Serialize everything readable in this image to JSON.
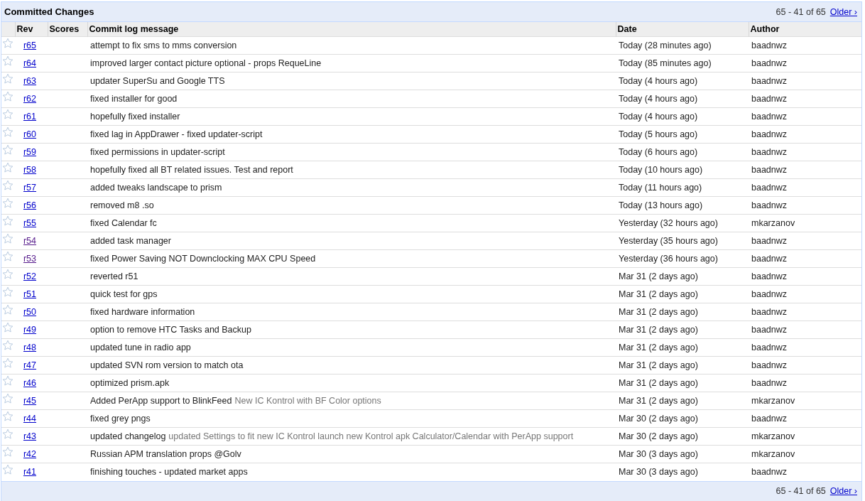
{
  "title": "Committed Changes",
  "pager": {
    "range": "65 - 41 of 65",
    "older": "Older ›"
  },
  "columns": [
    "Rev",
    "Scores",
    "Commit log message",
    "Date",
    "Author"
  ],
  "rows": [
    {
      "rev": "r65",
      "visited": false,
      "starred": false,
      "message": "attempt to fix sms to mms conversion",
      "date": "Today (28 minutes ago)",
      "author": "baadnwz"
    },
    {
      "rev": "r64",
      "visited": false,
      "starred": false,
      "message": "improved larger contact picture optional - props RequeLine",
      "date": "Today (85 minutes ago)",
      "author": "baadnwz"
    },
    {
      "rev": "r63",
      "visited": false,
      "starred": false,
      "message": "updater SuperSu and Google TTS",
      "date": "Today (4 hours ago)",
      "author": "baadnwz"
    },
    {
      "rev": "r62",
      "visited": false,
      "starred": false,
      "message": "fixed installer for good",
      "date": "Today (4 hours ago)",
      "author": "baadnwz"
    },
    {
      "rev": "r61",
      "visited": false,
      "starred": false,
      "message": "hopefully fixed installer",
      "date": "Today (4 hours ago)",
      "author": "baadnwz"
    },
    {
      "rev": "r60",
      "visited": false,
      "starred": false,
      "message": "fixed lag in AppDrawer - fixed updater-script",
      "date": "Today (5 hours ago)",
      "author": "baadnwz"
    },
    {
      "rev": "r59",
      "visited": false,
      "starred": false,
      "message": "fixed permissions in updater-script",
      "date": "Today (6 hours ago)",
      "author": "baadnwz"
    },
    {
      "rev": "r58",
      "visited": false,
      "starred": false,
      "message": "hopefully fixed all BT related issues. Test and report",
      "date": "Today (10 hours ago)",
      "author": "baadnwz"
    },
    {
      "rev": "r57",
      "visited": false,
      "starred": false,
      "message": "added tweaks landscape to prism",
      "date": "Today (11 hours ago)",
      "author": "baadnwz"
    },
    {
      "rev": "r56",
      "visited": false,
      "starred": false,
      "message": "removed m8 .so",
      "date": "Today (13 hours ago)",
      "author": "baadnwz"
    },
    {
      "rev": "r55",
      "visited": false,
      "starred": false,
      "message": "fixed Calendar fc",
      "date": "Yesterday (32 hours ago)",
      "author": "mkarzanov"
    },
    {
      "rev": "r54",
      "visited": true,
      "starred": false,
      "message": "added task manager",
      "date": "Yesterday (35 hours ago)",
      "author": "baadnwz"
    },
    {
      "rev": "r53",
      "visited": true,
      "starred": false,
      "message": "fixed Power Saving NOT Downclocking MAX CPU Speed",
      "date": "Yesterday (36 hours ago)",
      "author": "baadnwz"
    },
    {
      "rev": "r52",
      "visited": false,
      "starred": false,
      "message": "reverted r51",
      "date": "Mar 31 (2 days ago)",
      "author": "baadnwz"
    },
    {
      "rev": "r51",
      "visited": false,
      "starred": false,
      "message": "quick test for gps",
      "date": "Mar 31 (2 days ago)",
      "author": "baadnwz"
    },
    {
      "rev": "r50",
      "visited": false,
      "starred": false,
      "message": "fixed hardware information",
      "date": "Mar 31 (2 days ago)",
      "author": "baadnwz"
    },
    {
      "rev": "r49",
      "visited": false,
      "starred": false,
      "message": "option to remove HTC Tasks and Backup",
      "date": "Mar 31 (2 days ago)",
      "author": "baadnwz"
    },
    {
      "rev": "r48",
      "visited": false,
      "starred": false,
      "message": "updated tune in radio app",
      "date": "Mar 31 (2 days ago)",
      "author": "baadnwz"
    },
    {
      "rev": "r47",
      "visited": false,
      "starred": false,
      "message": "updated SVN rom version to match ota",
      "date": "Mar 31 (2 days ago)",
      "author": "baadnwz"
    },
    {
      "rev": "r46",
      "visited": false,
      "starred": false,
      "message": "optimized prism.apk",
      "date": "Mar 31 (2 days ago)",
      "author": "baadnwz"
    },
    {
      "rev": "r45",
      "visited": false,
      "starred": false,
      "message": "Added PerApp support to BlinkFeed",
      "detail": "New IC Kontrol with BF Color options",
      "date": "Mar 31 (2 days ago)",
      "author": "mkarzanov"
    },
    {
      "rev": "r44",
      "visited": false,
      "starred": false,
      "message": "fixed grey pngs",
      "date": "Mar 30 (2 days ago)",
      "author": "baadnwz"
    },
    {
      "rev": "r43",
      "visited": false,
      "starred": false,
      "message": "updated changelog",
      "detail": "updated Settings to fit new IC Kontrol launch new Kontrol apk Calculator/Calendar with PerApp support",
      "date": "Mar 30 (2 days ago)",
      "author": "mkarzanov"
    },
    {
      "rev": "r42",
      "visited": false,
      "starred": false,
      "message": "Russian APM translation props @Golv",
      "date": "Mar 30 (3 days ago)",
      "author": "mkarzanov"
    },
    {
      "rev": "r41",
      "visited": false,
      "starred": false,
      "message": "finishing touches - updated market apps",
      "date": "Mar 30 (3 days ago)",
      "author": "baadnwz"
    }
  ],
  "footer": {
    "range": "65 - 41 of 65",
    "older": "Older ›"
  }
}
